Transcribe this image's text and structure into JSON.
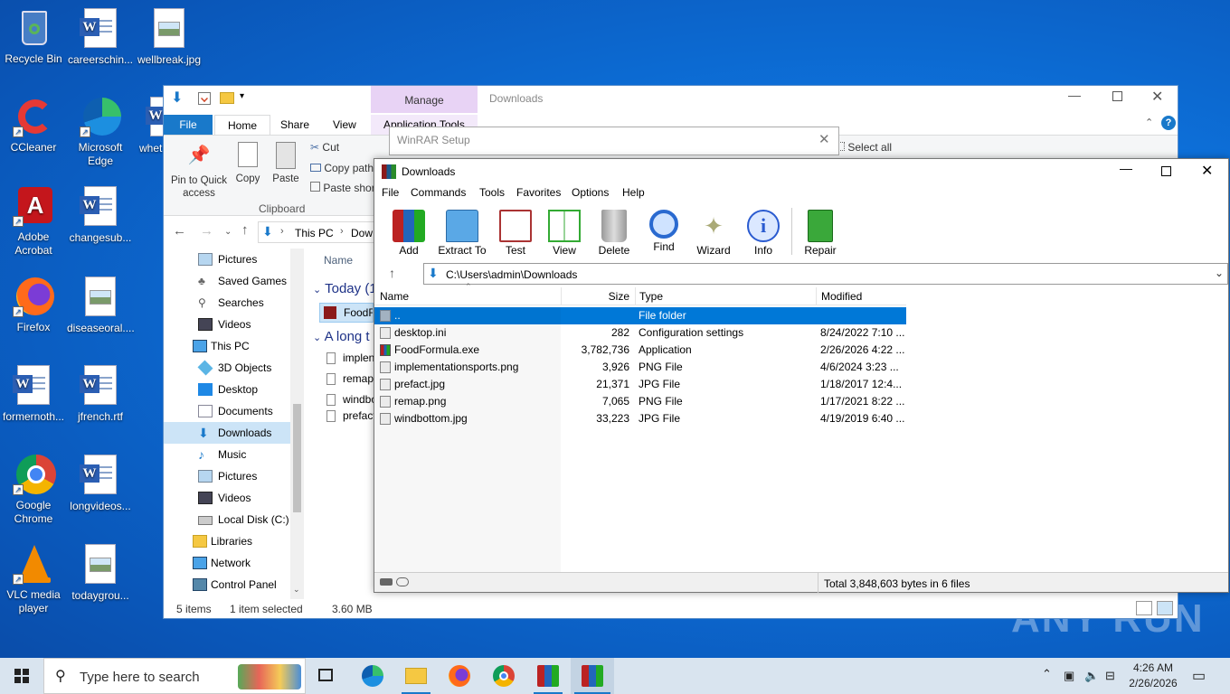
{
  "desktop": {
    "icons": [
      {
        "label": "Recycle Bin"
      },
      {
        "label": "careerschin..."
      },
      {
        "label": "wellbreak.jpg"
      },
      {
        "label": "CCleaner"
      },
      {
        "label": "Microsoft Edge"
      },
      {
        "label": "whet"
      },
      {
        "label": "Adobe Acrobat"
      },
      {
        "label": "changesub..."
      },
      {
        "label": "Firefox"
      },
      {
        "label": "diseaseoral...."
      },
      {
        "label": "formernoth..."
      },
      {
        "label": "jfrench.rtf"
      },
      {
        "label": "Google Chrome"
      },
      {
        "label": "longvideos..."
      },
      {
        "label": "VLC media player"
      },
      {
        "label": "todaygrou..."
      }
    ],
    "watermark": "ANY RUN"
  },
  "explorer": {
    "title": "Downloads",
    "manage_tab": "Manage",
    "app_tools_tab": "Application Tools",
    "tabs": {
      "file": "File",
      "home": "Home",
      "share": "Share",
      "view": "View"
    },
    "ribbon": {
      "pin": "Pin to Quick access",
      "copy": "Copy",
      "paste": "Paste",
      "cut": "Cut",
      "copy_path": "Copy path",
      "paste_shortcut": "Paste shor",
      "clipboard": "Clipboard",
      "select_all": "Select all"
    },
    "address": {
      "this_pc": "This PC",
      "downloads": "Dow"
    },
    "nav": [
      "Pictures",
      "Saved Games",
      "Searches",
      "Videos",
      "This PC",
      "3D Objects",
      "Desktop",
      "Documents",
      "Downloads",
      "Music",
      "Pictures",
      "Videos",
      "Local Disk (C:)",
      "Libraries",
      "Network",
      "Control Panel"
    ],
    "content": {
      "name_header": "Name",
      "group_today": "Today (1",
      "group_long": "A long t",
      "items": [
        "FoodFo",
        "implen",
        "remap.",
        "windbo",
        "prefact"
      ]
    },
    "status": {
      "items": "5 items",
      "selected": "1 item selected",
      "size": "3.60 MB"
    }
  },
  "setup": {
    "title": "WinRAR Setup"
  },
  "winrar": {
    "title": "Downloads",
    "menu": [
      "File",
      "Commands",
      "Tools",
      "Favorites",
      "Options",
      "Help"
    ],
    "toolbar": [
      "Add",
      "Extract To",
      "Test",
      "View",
      "Delete",
      "Find",
      "Wizard",
      "Info",
      "Repair"
    ],
    "path": "C:\\Users\\admin\\Downloads",
    "columns": {
      "name": "Name",
      "size": "Size",
      "type": "Type",
      "modified": "Modified"
    },
    "files": [
      {
        "name": "..",
        "size": "",
        "type": "File folder",
        "modified": ""
      },
      {
        "name": "desktop.ini",
        "size": "282",
        "type": "Configuration settings",
        "modified": "8/24/2022 7:10 ..."
      },
      {
        "name": "FoodFormula.exe",
        "size": "3,782,736",
        "type": "Application",
        "modified": "2/26/2026 4:22 ..."
      },
      {
        "name": "implementationsports.png",
        "size": "3,926",
        "type": "PNG File",
        "modified": "4/6/2024 3:23 ..."
      },
      {
        "name": "prefact.jpg",
        "size": "21,371",
        "type": "JPG File",
        "modified": "1/18/2017 12:4..."
      },
      {
        "name": "remap.png",
        "size": "7,065",
        "type": "PNG File",
        "modified": "1/17/2021 8:22 ..."
      },
      {
        "name": "windbottom.jpg",
        "size": "33,223",
        "type": "JPG File",
        "modified": "4/19/2019 6:40 ..."
      }
    ],
    "status": "Total 3,848,603 bytes in 6 files"
  },
  "taskbar": {
    "search_placeholder": "Type here to search",
    "time": "4:26 AM",
    "date": "2/26/2026"
  },
  "colors": {
    "selection": "#0078d7",
    "accent": "#1979ca",
    "manage": "#e8d3f5"
  }
}
